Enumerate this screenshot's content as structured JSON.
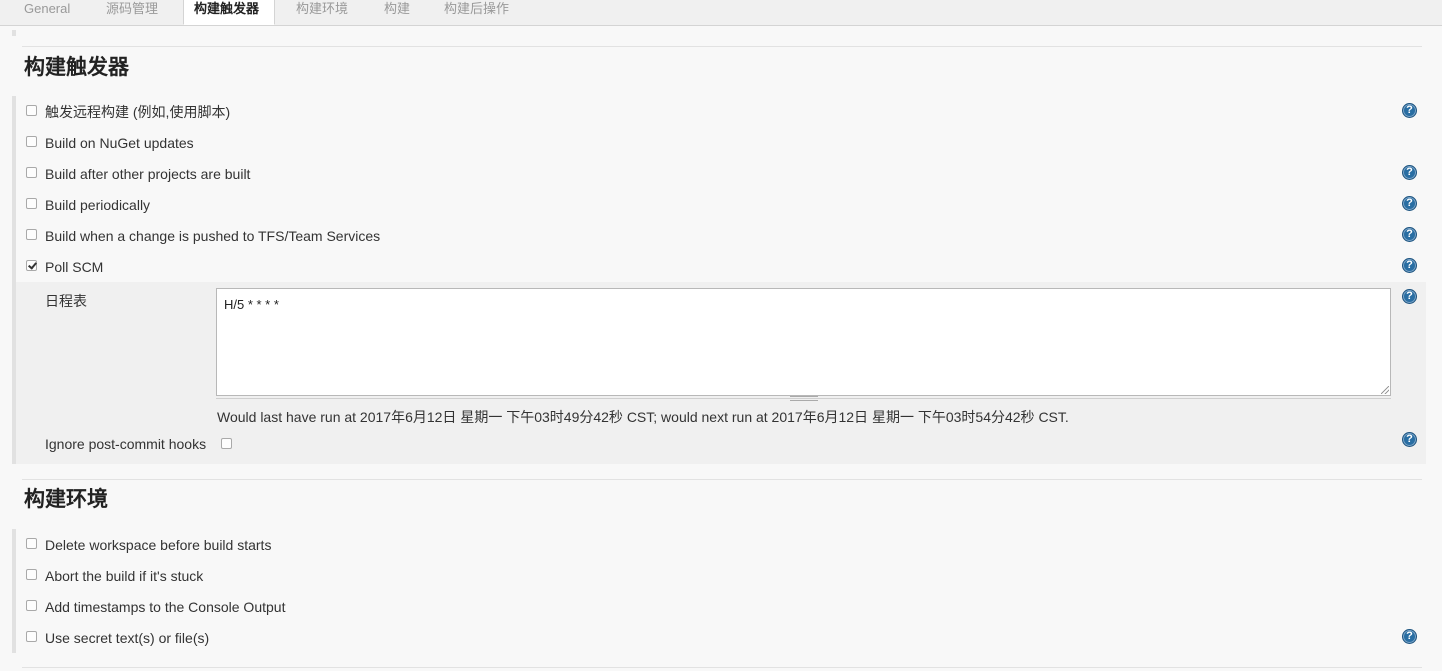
{
  "tabs": [
    {
      "label": "General"
    },
    {
      "label": "源码管理"
    },
    {
      "label": "构建触发器"
    },
    {
      "label": "构建环境"
    },
    {
      "label": "构建"
    },
    {
      "label": "构建后操作"
    }
  ],
  "triggers": {
    "title": "构建触发器",
    "options": [
      {
        "label": "触发远程构建 (例如,使用脚本)",
        "checked": false
      },
      {
        "label": "Build on NuGet updates",
        "checked": false
      },
      {
        "label": "Build after other projects are built",
        "checked": false
      },
      {
        "label": "Build periodically",
        "checked": false
      },
      {
        "label": "Build when a change is pushed to TFS/Team Services",
        "checked": false
      },
      {
        "label": "Poll SCM",
        "checked": true
      }
    ],
    "poll_scm": {
      "schedule_label": "日程表",
      "schedule_value": "H/5 * * * *",
      "schedule_note": "Would last have run at 2017年6月12日 星期一 下午03时49分42秒 CST; would next run at 2017年6月12日 星期一 下午03时54分42秒 CST.",
      "ignore_hooks_label": "Ignore post-commit hooks",
      "ignore_hooks_checked": false
    }
  },
  "environment": {
    "title": "构建环境",
    "options": [
      {
        "label": "Delete workspace before build starts",
        "checked": false
      },
      {
        "label": "Abort the build if it's stuck",
        "checked": false
      },
      {
        "label": "Add timestamps to the Console Output",
        "checked": false
      },
      {
        "label": "Use secret text(s) or file(s)",
        "checked": false
      }
    ]
  },
  "help_glyph": "?",
  "colors": {
    "accent": "#296ea3",
    "background": "#f8f8f8"
  }
}
